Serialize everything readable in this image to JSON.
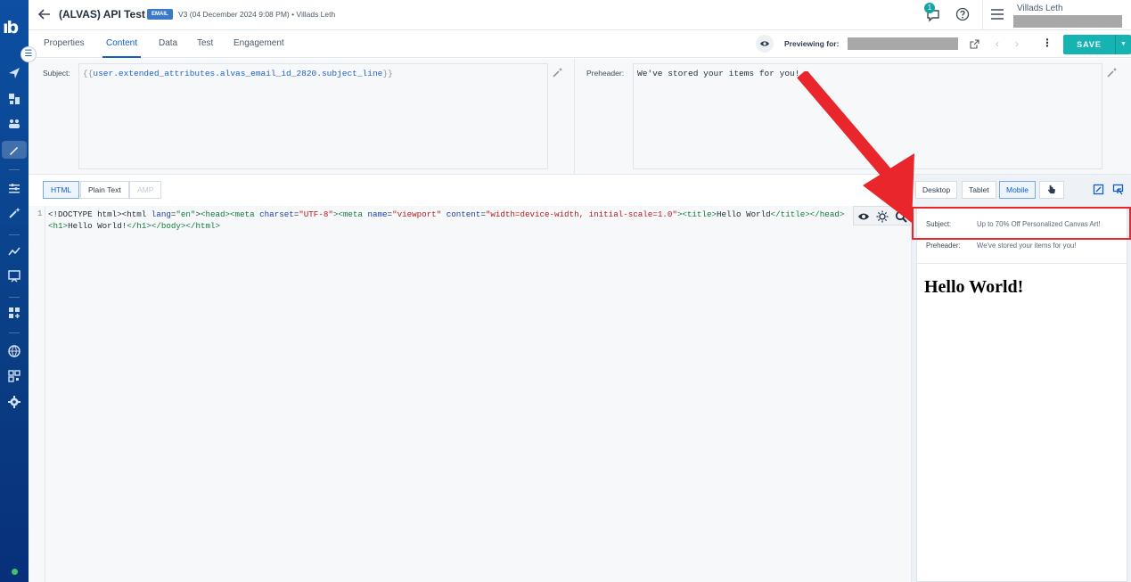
{
  "header": {
    "title": "(ALVAS) API Test",
    "badge": "EMAIL",
    "version": "V3 (04 December 2024 9:08 PM)  •  Villads Leth",
    "notifications": "1",
    "user_name": "Villads Leth"
  },
  "tabs": {
    "properties": "Properties",
    "content": "Content",
    "data": "Data",
    "test": "Test",
    "engagement": "Engagement"
  },
  "toolbar": {
    "previewing_for": "Previewing for:",
    "save_label": "SAVE"
  },
  "fields": {
    "subject_label": "Subject:",
    "subject_open": "{{",
    "subject_var": "user.extended_attributes.alvas_email_id_2820.subject_line",
    "subject_close": "}}",
    "preheader_label": "Preheader:",
    "preheader_value": "We've stored your items for you!"
  },
  "editor": {
    "tab_html": "HTML",
    "tab_plain": "Plain Text",
    "tab_amp": "AMP",
    "line_number": "1",
    "code_tokens": {
      "doctype": "<!DOCTYPE html>",
      "html_open": "<html ",
      "lang_attr": "lang",
      "eq1": "=",
      "lang_val": "\"en\"",
      "gt1": ">",
      "head_open": "<head>",
      "meta1_open": "<meta ",
      "charset_attr": "charset",
      "eq2": "=",
      "charset_val": "\"UTF-8\"",
      "gt2": ">",
      "meta2_open": "<meta ",
      "name_attr": "name",
      "eq3": "=",
      "name_val": "\"viewport\"",
      "sp1": " ",
      "content_attr": "content",
      "eq4": "=",
      "content_val": "\"width=device-width, initial-scale=1.0\"",
      "gt3": ">",
      "title_open": "<title>",
      "title_text": "Hello World",
      "title_close": "</title>",
      "head_close": "</head>",
      "body_open": "<body>",
      "h1_open": "<h1>",
      "h1_text": "Hello World!",
      "h1_close": "</h1>",
      "body_close": "</body>",
      "html_close": "</html>"
    }
  },
  "preview": {
    "tab_desktop": "Desktop",
    "tab_tablet": "Tablet",
    "tab_mobile": "Mobile",
    "subject_label": "Subject:",
    "subject_value": "Up to 70% Off Personalized Canvas Art!",
    "preheader_label": "Preheader:",
    "preheader_value": "We've stored your items for you!",
    "heading": "Hello World!"
  },
  "colors": {
    "rail": "#0d4fa3",
    "accent": "#0f5fc4",
    "save": "#16b3b3",
    "highlight": "#e8262b"
  }
}
